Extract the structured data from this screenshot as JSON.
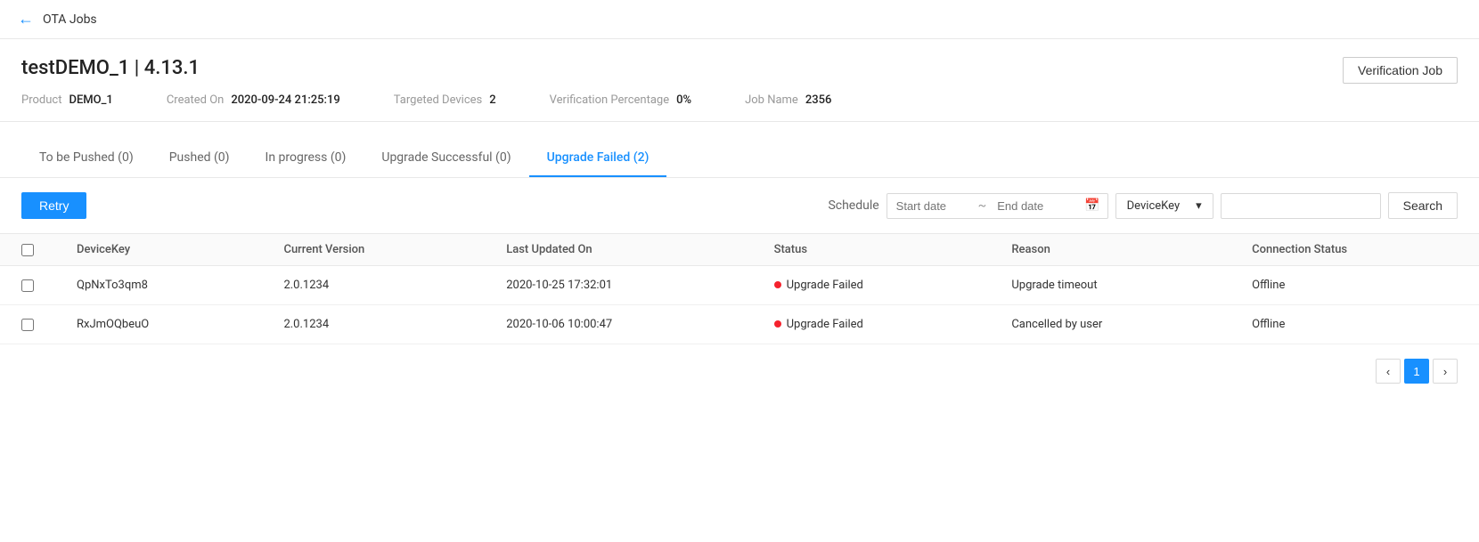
{
  "nav": {
    "back_label": "←",
    "page_title": "OTA Jobs"
  },
  "header": {
    "job_title": "testDEMO_1 | 4.13.1",
    "verification_job_label": "Verification Job",
    "meta": {
      "product_label": "Product",
      "product_value": "DEMO_1",
      "created_on_label": "Created On",
      "created_on_value": "2020-09-24 21:25:19",
      "targeted_devices_label": "Targeted Devices",
      "targeted_devices_value": "2",
      "verification_pct_label": "Verification Percentage",
      "verification_pct_value": "0%",
      "job_name_label": "Job Name",
      "job_name_value": "2356"
    }
  },
  "tabs": [
    {
      "id": "to_be_pushed",
      "label": "To be Pushed (0)",
      "active": false
    },
    {
      "id": "pushed",
      "label": "Pushed (0)",
      "active": false
    },
    {
      "id": "in_progress",
      "label": "In progress (0)",
      "active": false
    },
    {
      "id": "upgrade_successful",
      "label": "Upgrade Successful (0)",
      "active": false
    },
    {
      "id": "upgrade_failed",
      "label": "Upgrade Failed (2)",
      "active": true
    }
  ],
  "toolbar": {
    "retry_label": "Retry",
    "schedule_label": "Schedule",
    "start_date_placeholder": "Start date",
    "end_date_placeholder": "End date",
    "filter_value": "DeviceKey",
    "search_label": "Search"
  },
  "table": {
    "columns": [
      {
        "id": "checkbox",
        "label": ""
      },
      {
        "id": "device_key",
        "label": "DeviceKey"
      },
      {
        "id": "current_version",
        "label": "Current Version"
      },
      {
        "id": "last_updated_on",
        "label": "Last Updated On"
      },
      {
        "id": "status",
        "label": "Status"
      },
      {
        "id": "reason",
        "label": "Reason"
      },
      {
        "id": "connection_status",
        "label": "Connection Status"
      }
    ],
    "rows": [
      {
        "device_key": "QpNxTo3qm8",
        "current_version": "2.0.1234",
        "last_updated_on": "2020-10-25 17:32:01",
        "status": "Upgrade Failed",
        "reason": "Upgrade timeout",
        "connection_status": "Offline"
      },
      {
        "device_key": "RxJmOQbeuO",
        "current_version": "2.0.1234",
        "last_updated_on": "2020-10-06 10:00:47",
        "status": "Upgrade Failed",
        "reason": "Cancelled by user",
        "connection_status": "Offline"
      }
    ]
  },
  "pagination": {
    "prev_label": "‹",
    "next_label": "›",
    "current_page": 1
  }
}
